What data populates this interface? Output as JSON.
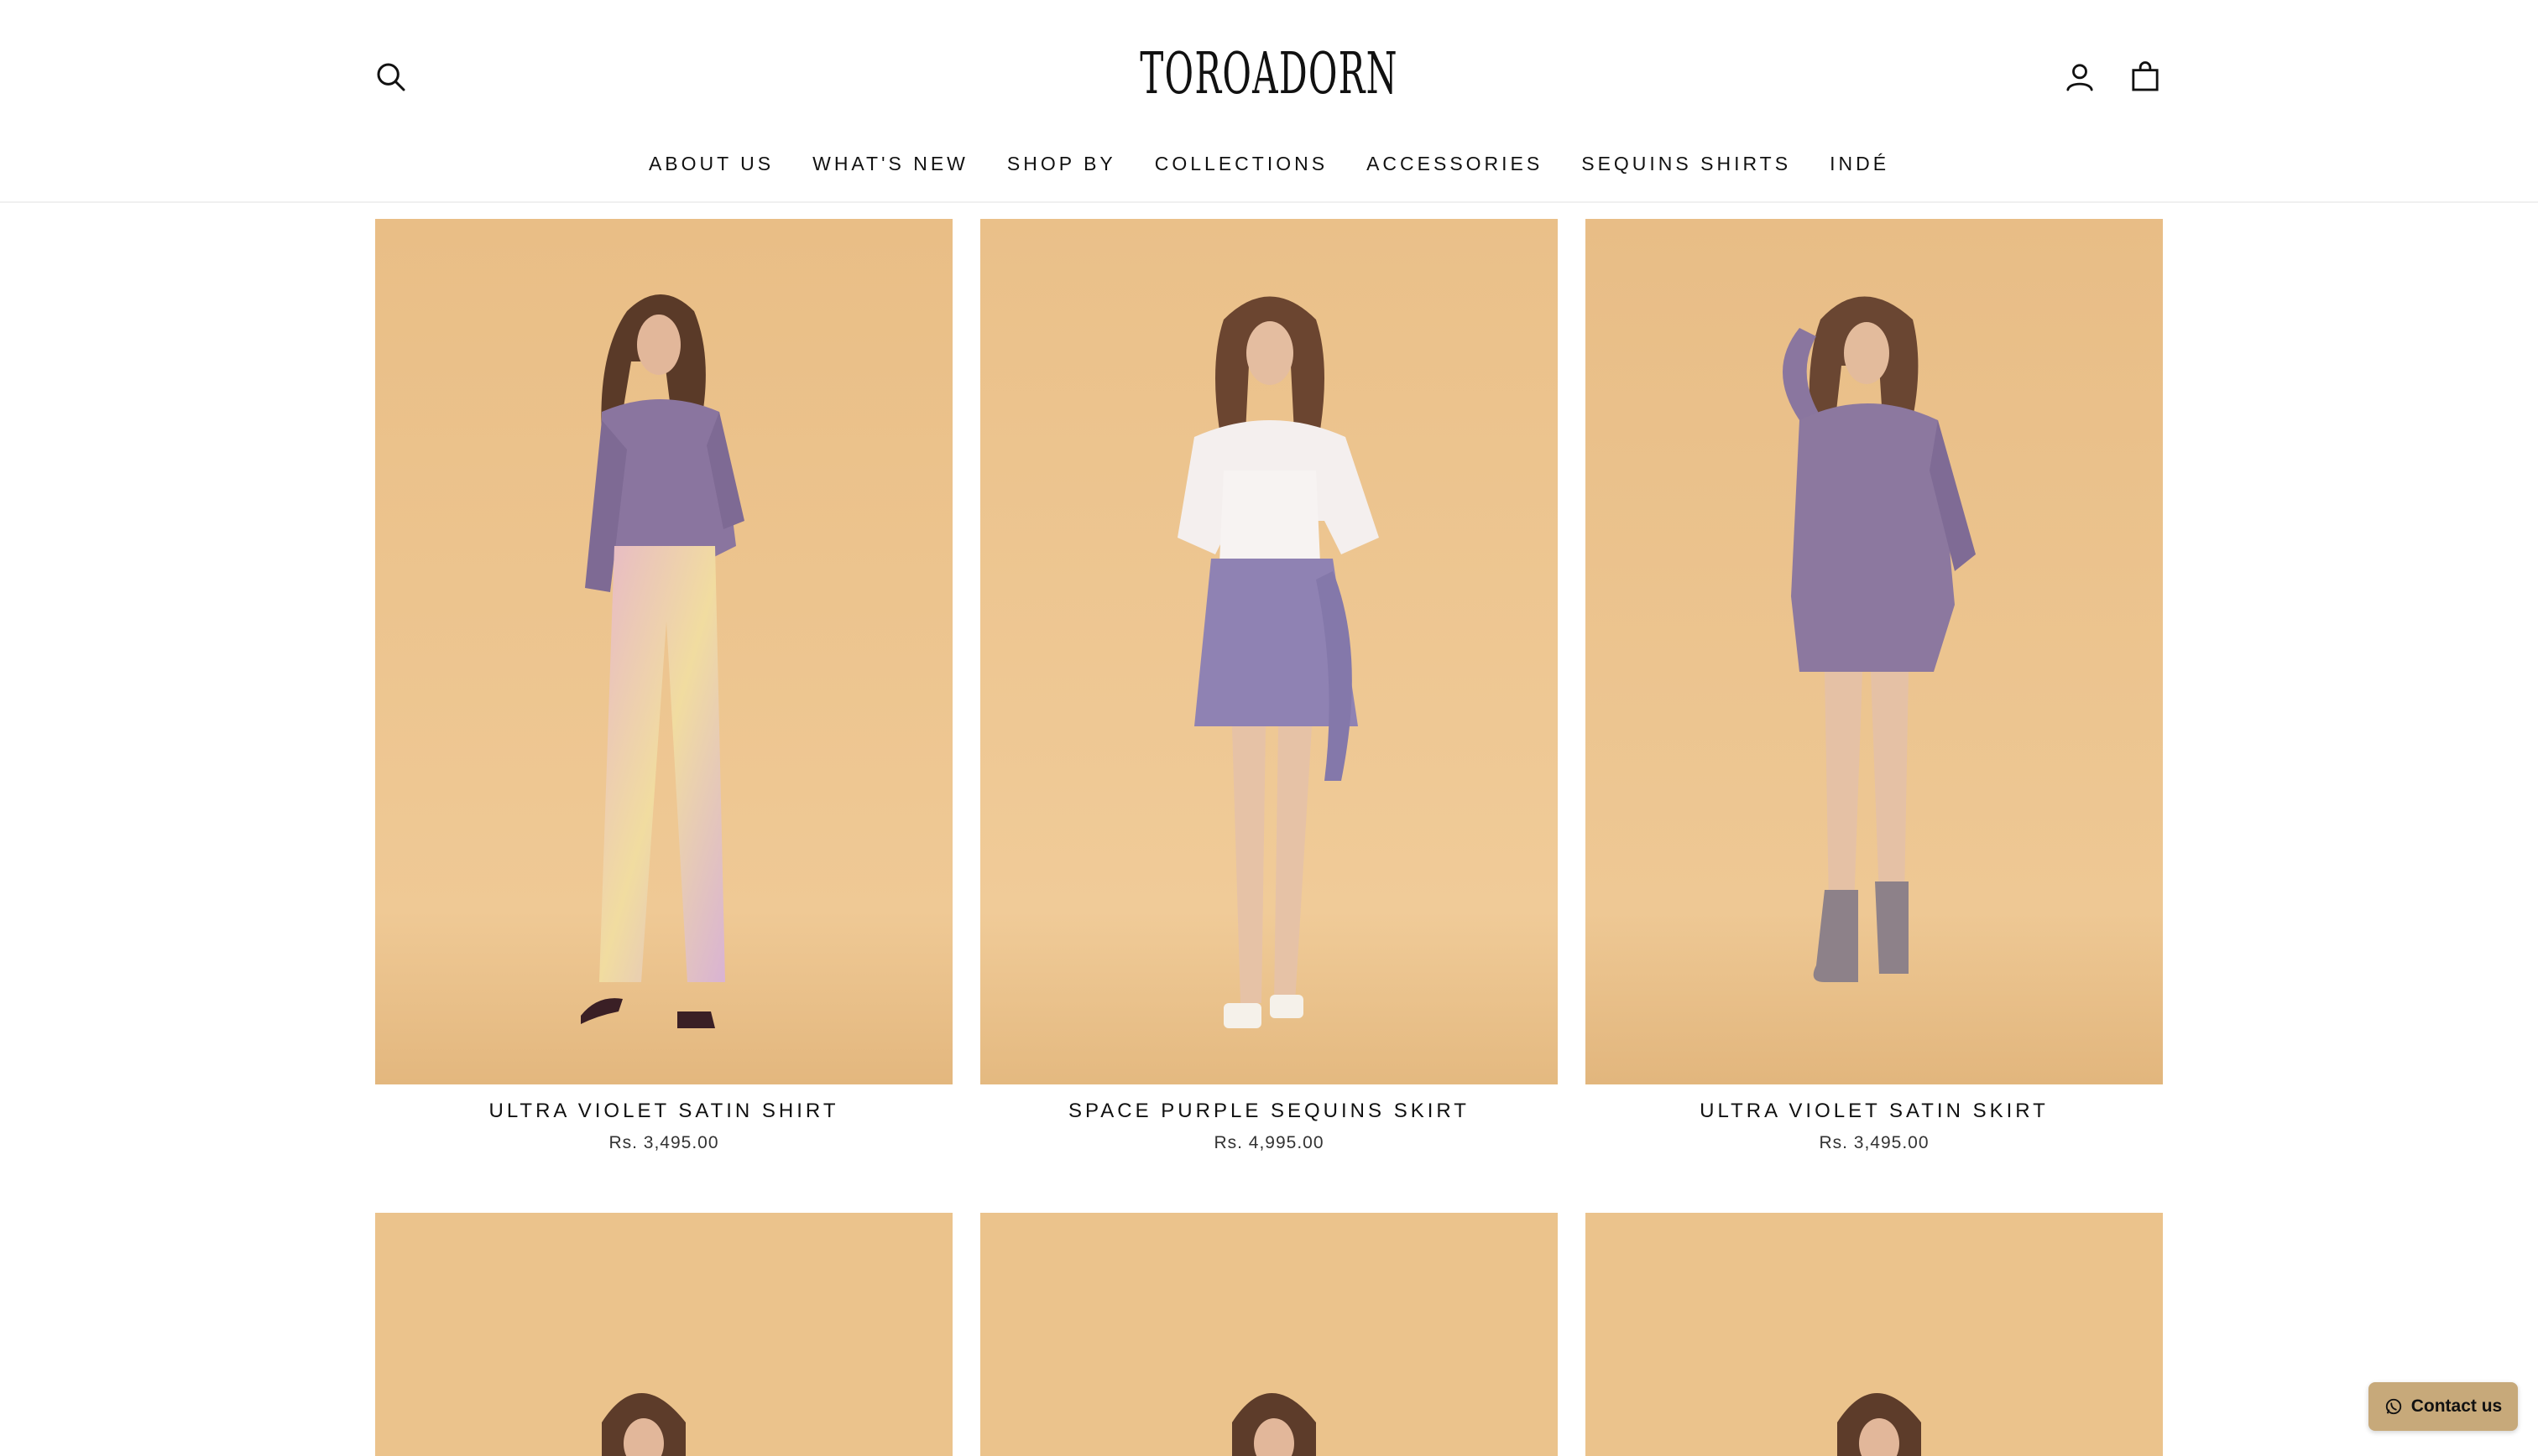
{
  "brand": {
    "logo_text": "TOROADORN"
  },
  "header": {
    "search_icon": "search-icon",
    "account_icon": "user-icon",
    "cart_icon": "bag-icon"
  },
  "nav": {
    "items": [
      {
        "label": "ABOUT US"
      },
      {
        "label": "WHAT'S NEW"
      },
      {
        "label": "SHOP BY"
      },
      {
        "label": "COLLECTIONS"
      },
      {
        "label": "ACCESSORIES"
      },
      {
        "label": "SEQUINS SHIRTS"
      },
      {
        "label": "INDÉ"
      }
    ]
  },
  "products": [
    {
      "title": "ULTRA VIOLET SATIN SHIRT",
      "price": "Rs. 3,495.00"
    },
    {
      "title": "SPACE PURPLE SEQUINS SKIRT",
      "price": "Rs. 4,995.00"
    },
    {
      "title": "ULTRA VIOLET SATIN SKIRT",
      "price": "Rs. 3,495.00"
    }
  ],
  "contact_button": {
    "label": "Contact us",
    "icon": "whatsapp-icon"
  },
  "colors": {
    "backdrop": "#ecc48e",
    "lavender": "#8d7aa8",
    "contact_bg": "#c7a97a"
  }
}
